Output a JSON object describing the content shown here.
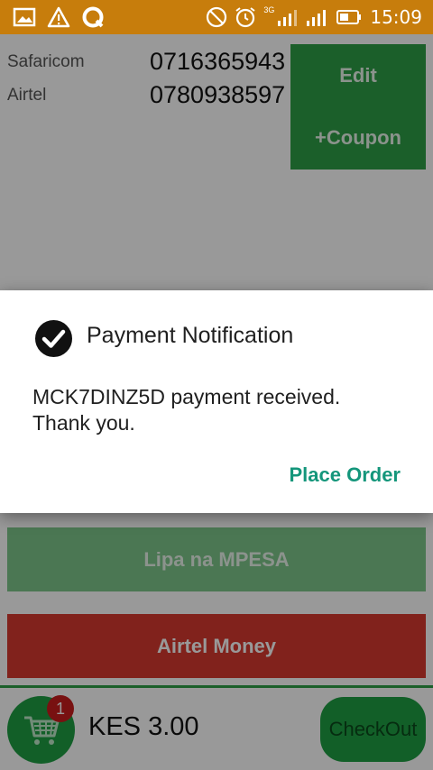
{
  "status_bar": {
    "time": "15:09",
    "network_label": "3G",
    "left_icons": [
      "image-icon",
      "warning-icon",
      "circle-app-icon"
    ],
    "right_icons": [
      "do-not-disturb-icon",
      "alarm-icon",
      "signal-icon",
      "signal-icon",
      "battery-icon"
    ],
    "background_color": "#c77d0c"
  },
  "contacts": [
    {
      "provider": "Safaricom",
      "number": "0716365943"
    },
    {
      "provider": "Airtel",
      "number": "0780938597"
    }
  ],
  "side_buttons": {
    "edit_label": "Edit",
    "coupon_label": "+Coupon"
  },
  "payment_buttons": {
    "mpesa_label": "Lipa na MPESA",
    "airtel_label": "Airtel Money"
  },
  "cart": {
    "count": "1",
    "total": "KES 3.00",
    "checkout_label": "CheckOut"
  },
  "dialog": {
    "title": "Payment Notification",
    "message_line1": "MCK7DINZ5D payment received.",
    "message_line2": "Thank you.",
    "action_label": "Place Order"
  },
  "colors": {
    "accent_green": "#2e9e47",
    "airtel_red": "#d83a30",
    "dialog_action": "#14967b"
  }
}
